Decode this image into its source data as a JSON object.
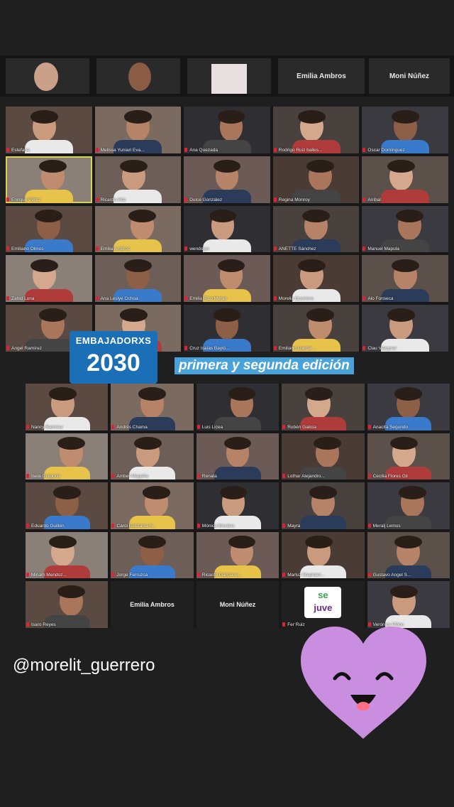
{
  "top_strip": {
    "names": [
      "Emilia Ambros",
      "Moni Núñez"
    ]
  },
  "upper_grid": {
    "labels": [
      "Estefana",
      "Melissa Yuniari Eva...",
      "Ana Quezada",
      "Rodrigo Ruiz balles...",
      "Oscar Domínguez",
      "Enrique Pérez",
      "Ricardo Hdz",
      "Dulce González",
      "Regina Monroy",
      "Aníbal",
      "Emiliano Olmos",
      "Emilia Ambros",
      "wendolyn",
      "ANETTE Sánchez",
      "Manuel Mapula",
      "Zahid Luna",
      "Ana Leslye Ochoa",
      "Emilia Rico Morán",
      "Morelia Guerrero",
      "Alo Fonseca",
      "Angel Ramírez",
      "",
      "Cruz Isaías Bayló...",
      "Emiliano García ...",
      "Clau Vázquez"
    ]
  },
  "badge": {
    "line1": "EMBAJADORXS",
    "line2": "2030"
  },
  "subtitle": "primera y segunda edición",
  "lower_grid": {
    "labels": [
      "Nancy Ramírez",
      "Andrés Chama",
      "Luis Licea",
      "Rubén Galicia",
      "Anacita Segundo",
      "Isela Gregorio",
      "Amber Magaña",
      "Renata",
      "Lothar Alejandro...",
      "Cecilia Flores Gil",
      "Eduardo Guillén",
      "Carol Estefania S...",
      "Mónica Morales",
      "Mayra",
      "Meralj Lemus",
      "Miriam Mendoz...",
      "Jorge Ferruzca",
      "Ricardo García-Li...",
      "Marluz Stephani...",
      "Gustavo Angel S...",
      "Isaro Reyes",
      "Emilia Ambros",
      "Moni Núñez",
      "Fer Ruiz",
      "Verónica Piñón"
    ]
  },
  "sejuve_logo": {
    "line1": "se",
    "line2": "juve"
  },
  "handle": "@morelit_guerrero",
  "colors": {
    "background": "#1f1f1f",
    "badge_blue": "#1b6fb6",
    "subtitle_blue": "#4aa3d8",
    "heart_purple": "#c98ee0",
    "active_speaker": "#d6d34a",
    "mic_muted": "#dd2233"
  }
}
